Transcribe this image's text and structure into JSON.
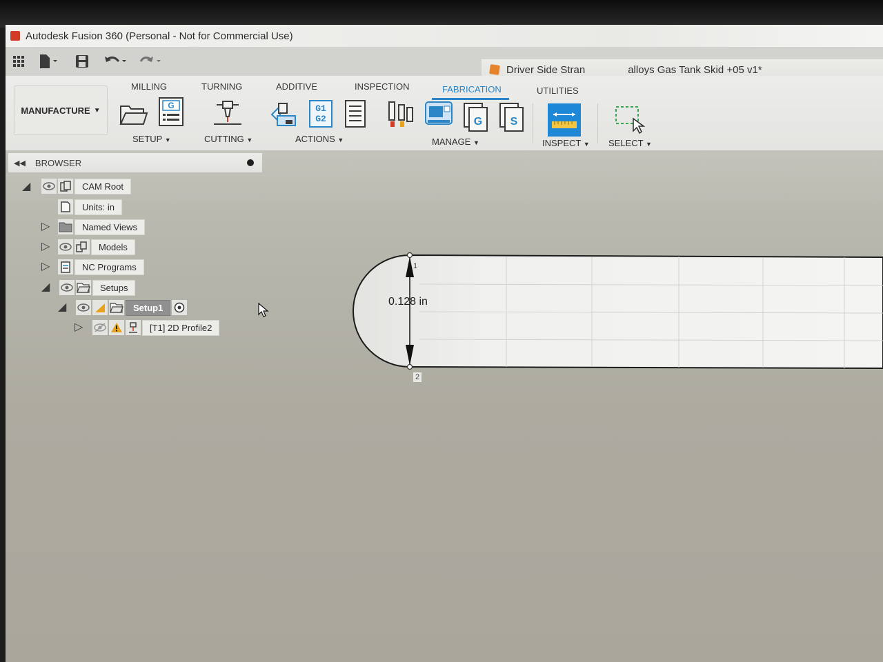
{
  "window": {
    "title": "Autodesk Fusion 360 (Personal - Not for Commercial Use)"
  },
  "document": {
    "title": "Driver Side Stran",
    "title_tail": "alloys Gas Tank Skid +05 v1*"
  },
  "ribbon": {
    "workspace": "MANUFACTURE",
    "tabs": [
      "MILLING",
      "TURNING",
      "ADDITIVE",
      "INSPECTION",
      "FABRICATION",
      "UTILITIES"
    ],
    "active_tab": "FABRICATION",
    "groups": {
      "setup": "SETUP",
      "cutting": "CUTTING",
      "actions": "ACTIONS",
      "manage": "MANAGE",
      "inspect": "INSPECT",
      "select": "SELECT"
    },
    "g1g2": "G1\nG2",
    "g_badge": "G",
    "s_badge": "S"
  },
  "browser": {
    "header": "BROWSER",
    "items": [
      {
        "label": "CAM Root"
      },
      {
        "label": "Units: in"
      },
      {
        "label": "Named Views"
      },
      {
        "label": "Models"
      },
      {
        "label": "NC Programs"
      },
      {
        "label": "Setups"
      },
      {
        "label": "Setup1"
      },
      {
        "label": "[T1] 2D Profile2"
      }
    ]
  },
  "viewport": {
    "dimension": "0.128 in",
    "point_1": "1",
    "point_2": "2"
  },
  "colors": {
    "accent": "#2a86c7",
    "warning": "#e8a21c",
    "inspect_blue": "#1e88d6"
  }
}
